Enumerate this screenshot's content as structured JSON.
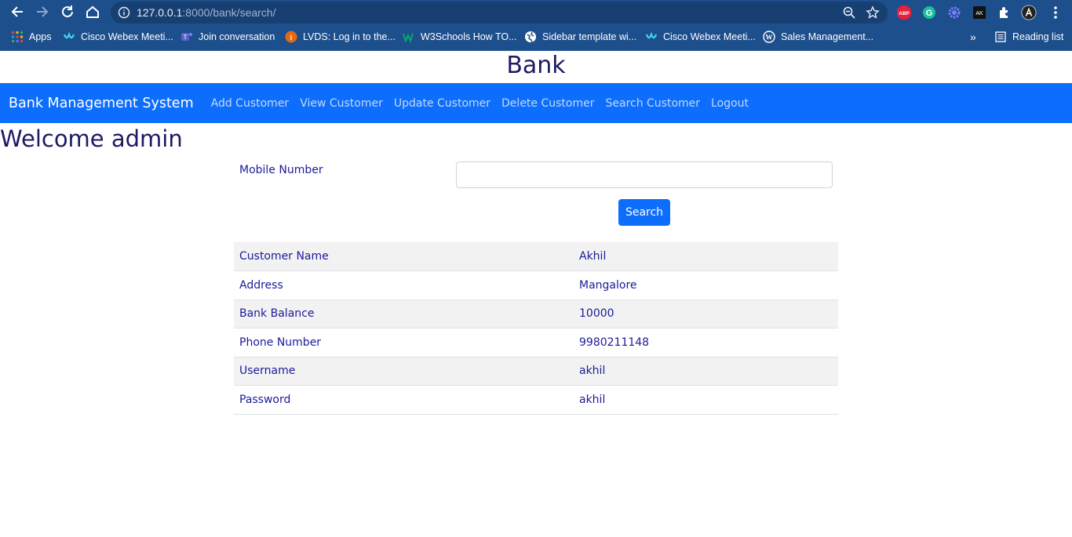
{
  "browser": {
    "url_host": "127.0.0.1",
    "url_rest": ":8000/bank/search/",
    "bookmarks": [
      {
        "label": "Apps",
        "icon": "apps-grid-icon"
      },
      {
        "label": "Cisco Webex Meeti...",
        "icon": "webex-icon"
      },
      {
        "label": "Join conversation",
        "icon": "teams-icon"
      },
      {
        "label": "LVDS: Log in to the...",
        "icon": "lvds-icon"
      },
      {
        "label": "W3Schools How TO...",
        "icon": "w3schools-icon"
      },
      {
        "label": "Sidebar template wi...",
        "icon": "globe-icon"
      },
      {
        "label": "Cisco Webex Meeti...",
        "icon": "webex-icon"
      },
      {
        "label": "Sales Management...",
        "icon": "wordpress-icon"
      }
    ],
    "reading_list": "Reading list",
    "more_bookmarks": "»",
    "extensions": {
      "abp": "ABP",
      "grammarly": "G",
      "ak": "AK"
    }
  },
  "page": {
    "title": "Bank",
    "navbar": {
      "brand": "Bank Management System",
      "links": [
        "Add Customer",
        "View Customer",
        "Update Customer",
        "Delete Customer",
        "Search Customer",
        "Logout"
      ]
    },
    "welcome": "Welcome admin",
    "form": {
      "mobile_label": "Mobile Number",
      "mobile_value": "",
      "search_label": "Search"
    },
    "result": [
      {
        "label": "Customer Name",
        "value": "Akhil"
      },
      {
        "label": "Address",
        "value": "Mangalore"
      },
      {
        "label": "Bank Balance",
        "value": "10000"
      },
      {
        "label": "Phone Number",
        "value": "9980211148"
      },
      {
        "label": "Username",
        "value": "akhil"
      },
      {
        "label": "Password",
        "value": "akhil"
      }
    ]
  },
  "colors": {
    "chrome": "#1d4f8c",
    "navbar": "#0d6efd",
    "heading": "#1c1a63",
    "text": "#1c1a9a"
  }
}
